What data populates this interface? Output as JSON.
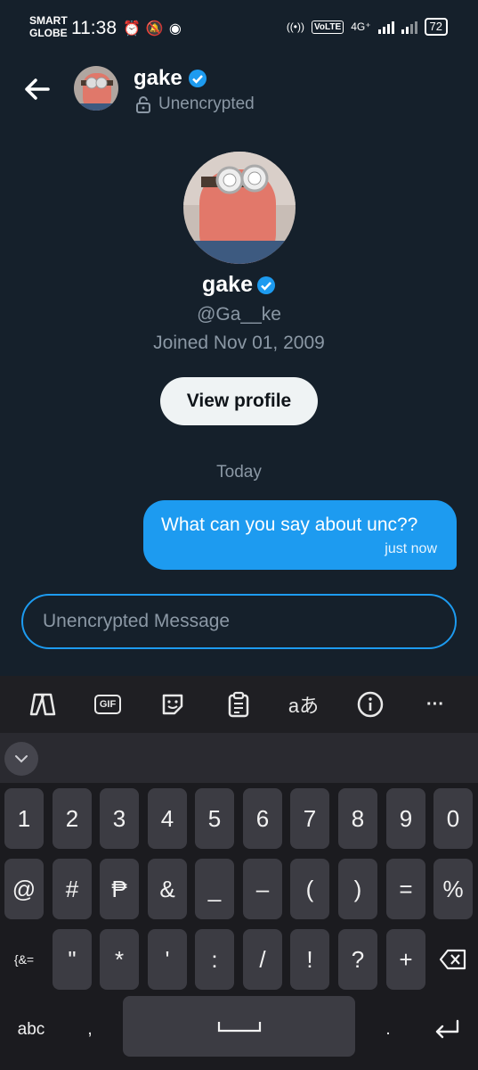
{
  "status_bar": {
    "carrier_line1": "SMART",
    "carrier_line2": "GLOBE",
    "time": "11:38",
    "signal_label": "4G⁺",
    "volte": "VoLTE",
    "battery": "72"
  },
  "header": {
    "name": "gake",
    "encryption_status": "Unencrypted"
  },
  "profile": {
    "name": "gake",
    "handle": "@Ga__ke",
    "joined": "Joined Nov 01, 2009",
    "view_profile_label": "View profile"
  },
  "conversation": {
    "day_divider": "Today",
    "messages": [
      {
        "text": "What can you say about unc??",
        "time": "just now"
      }
    ]
  },
  "composer": {
    "placeholder": "Unencrypted Message",
    "value": ""
  },
  "keyboard": {
    "toolbar": [
      "copilot-icon",
      "gif-icon",
      "sticker-icon",
      "clipboard-icon",
      "translate-icon",
      "info-icon",
      "more-icon"
    ],
    "gif_label": "GIF",
    "translate_label": "aあ",
    "more_label": "···",
    "row1": [
      "1",
      "2",
      "3",
      "4",
      "5",
      "6",
      "7",
      "8",
      "9",
      "0"
    ],
    "row2": [
      "@",
      "#",
      "₱",
      "&",
      "_",
      "–",
      "(",
      ")",
      "=",
      "%"
    ],
    "row3_switch": "{&=",
    "row3": [
      "\"",
      "*",
      "'",
      ":",
      "/",
      "!",
      "?",
      "+"
    ],
    "abc": "abc",
    "comma": ",",
    "period": "."
  },
  "colors": {
    "background": "#15202b",
    "accent": "#1d9bf0",
    "muted_text": "#8b98a5"
  }
}
